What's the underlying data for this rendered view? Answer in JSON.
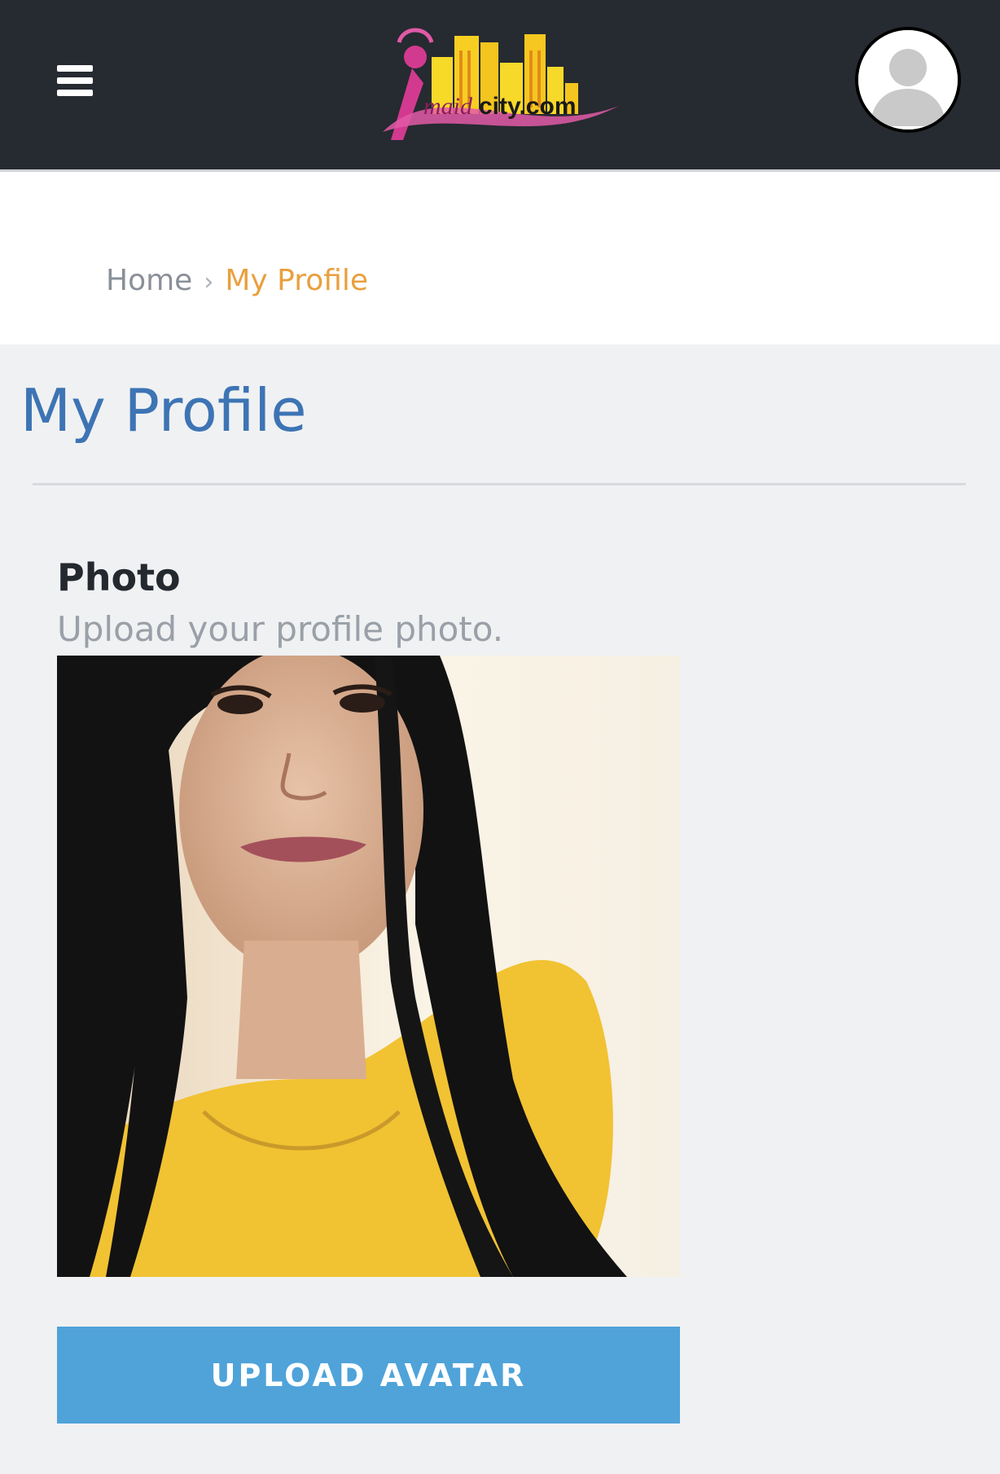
{
  "header": {
    "logo_text": "maidcity.com",
    "menu_icon": "hamburger-icon",
    "avatar_icon": "user-silhouette-icon"
  },
  "breadcrumb": {
    "home": "Home",
    "separator_icon": "chevron-right-icon",
    "current": "My Profile"
  },
  "page": {
    "title": "My Profile"
  },
  "photo_section": {
    "title": "Photo",
    "description": "Upload your profile photo.",
    "upload_button": "UPLOAD AVATAR"
  },
  "colors": {
    "topbar": "#262a31",
    "title_blue": "#3d74b4",
    "breadcrumb_active": "#e9a03f",
    "button_blue": "#4fa3d9",
    "page_bg": "#f0f1f3"
  }
}
